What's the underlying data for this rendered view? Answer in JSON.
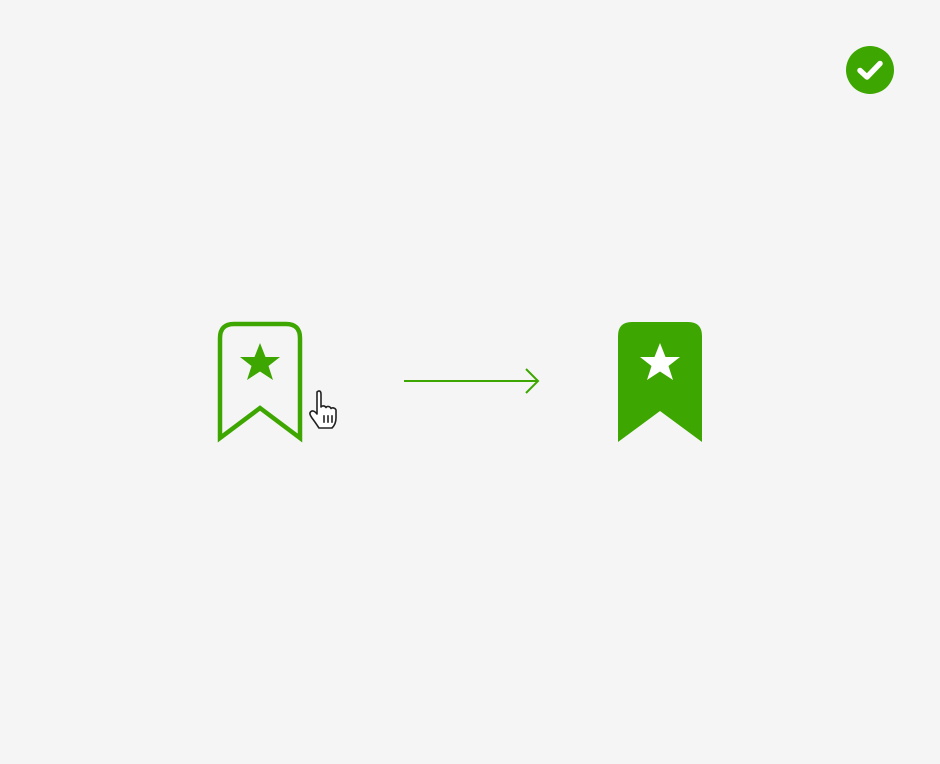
{
  "colors": {
    "background": "#f5f5f5",
    "accent": "#3ea600",
    "inner_star": "#ffffff",
    "cursor_outline": "#222222",
    "cursor_fill": "#ffffff"
  },
  "icons": {
    "status": "check-circle-icon",
    "before_state": "bookmark-star-outline-icon",
    "cursor": "hand-pointer-icon",
    "transition": "arrow-right-icon",
    "after_state": "bookmark-star-filled-icon"
  }
}
